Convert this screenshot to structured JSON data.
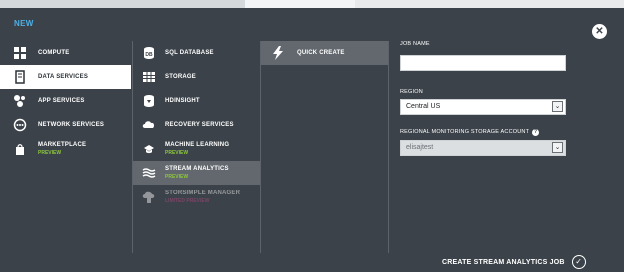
{
  "dialog": {
    "title": "NEW",
    "close_symbol": "✕"
  },
  "categories": [
    {
      "label": "COMPUTE",
      "icon": "compute-icon",
      "selected": false
    },
    {
      "label": "DATA SERVICES",
      "icon": "data-services-icon",
      "selected": true
    },
    {
      "label": "APP SERVICES",
      "icon": "app-services-icon",
      "selected": false
    },
    {
      "label": "NETWORK SERVICES",
      "icon": "network-services-icon",
      "selected": false
    },
    {
      "label": "MARKETPLACE",
      "sublabel": "PREVIEW",
      "icon": "marketplace-icon",
      "selected": false
    }
  ],
  "services": [
    {
      "label": "SQL DATABASE",
      "icon": "sql-database-icon"
    },
    {
      "label": "STORAGE",
      "icon": "storage-icon"
    },
    {
      "label": "HDINSIGHT",
      "icon": "hdinsight-icon"
    },
    {
      "label": "RECOVERY SERVICES",
      "icon": "recovery-services-icon"
    },
    {
      "label": "MACHINE LEARNING",
      "sublabel": "PREVIEW",
      "icon": "machine-learning-icon"
    },
    {
      "label": "STREAM ANALYTICS",
      "sublabel": "PREVIEW",
      "icon": "stream-analytics-icon",
      "selected": true
    },
    {
      "label": "STORSIMPLE MANAGER",
      "sublabel": "LIMITED PREVIEW",
      "icon": "storsimple-icon",
      "disabled": true
    }
  ],
  "create_options": {
    "quick_create": "QUICK CREATE"
  },
  "form": {
    "job_name_label": "JOB NAME",
    "job_name_value": "",
    "region_label": "REGION",
    "region_value": "Central US",
    "storage_label": "REGIONAL MONITORING STORAGE ACCOUNT",
    "storage_value": "elisajtest"
  },
  "footer": {
    "create_label": "CREATE STREAM ANALYTICS JOB",
    "check_symbol": "✓"
  },
  "colors": {
    "accent": "#4fb0e6",
    "panel": "#3b4249",
    "preview": "#8dc63f",
    "limited_preview": "#c04a8a",
    "selected_dark": "#62686e"
  }
}
